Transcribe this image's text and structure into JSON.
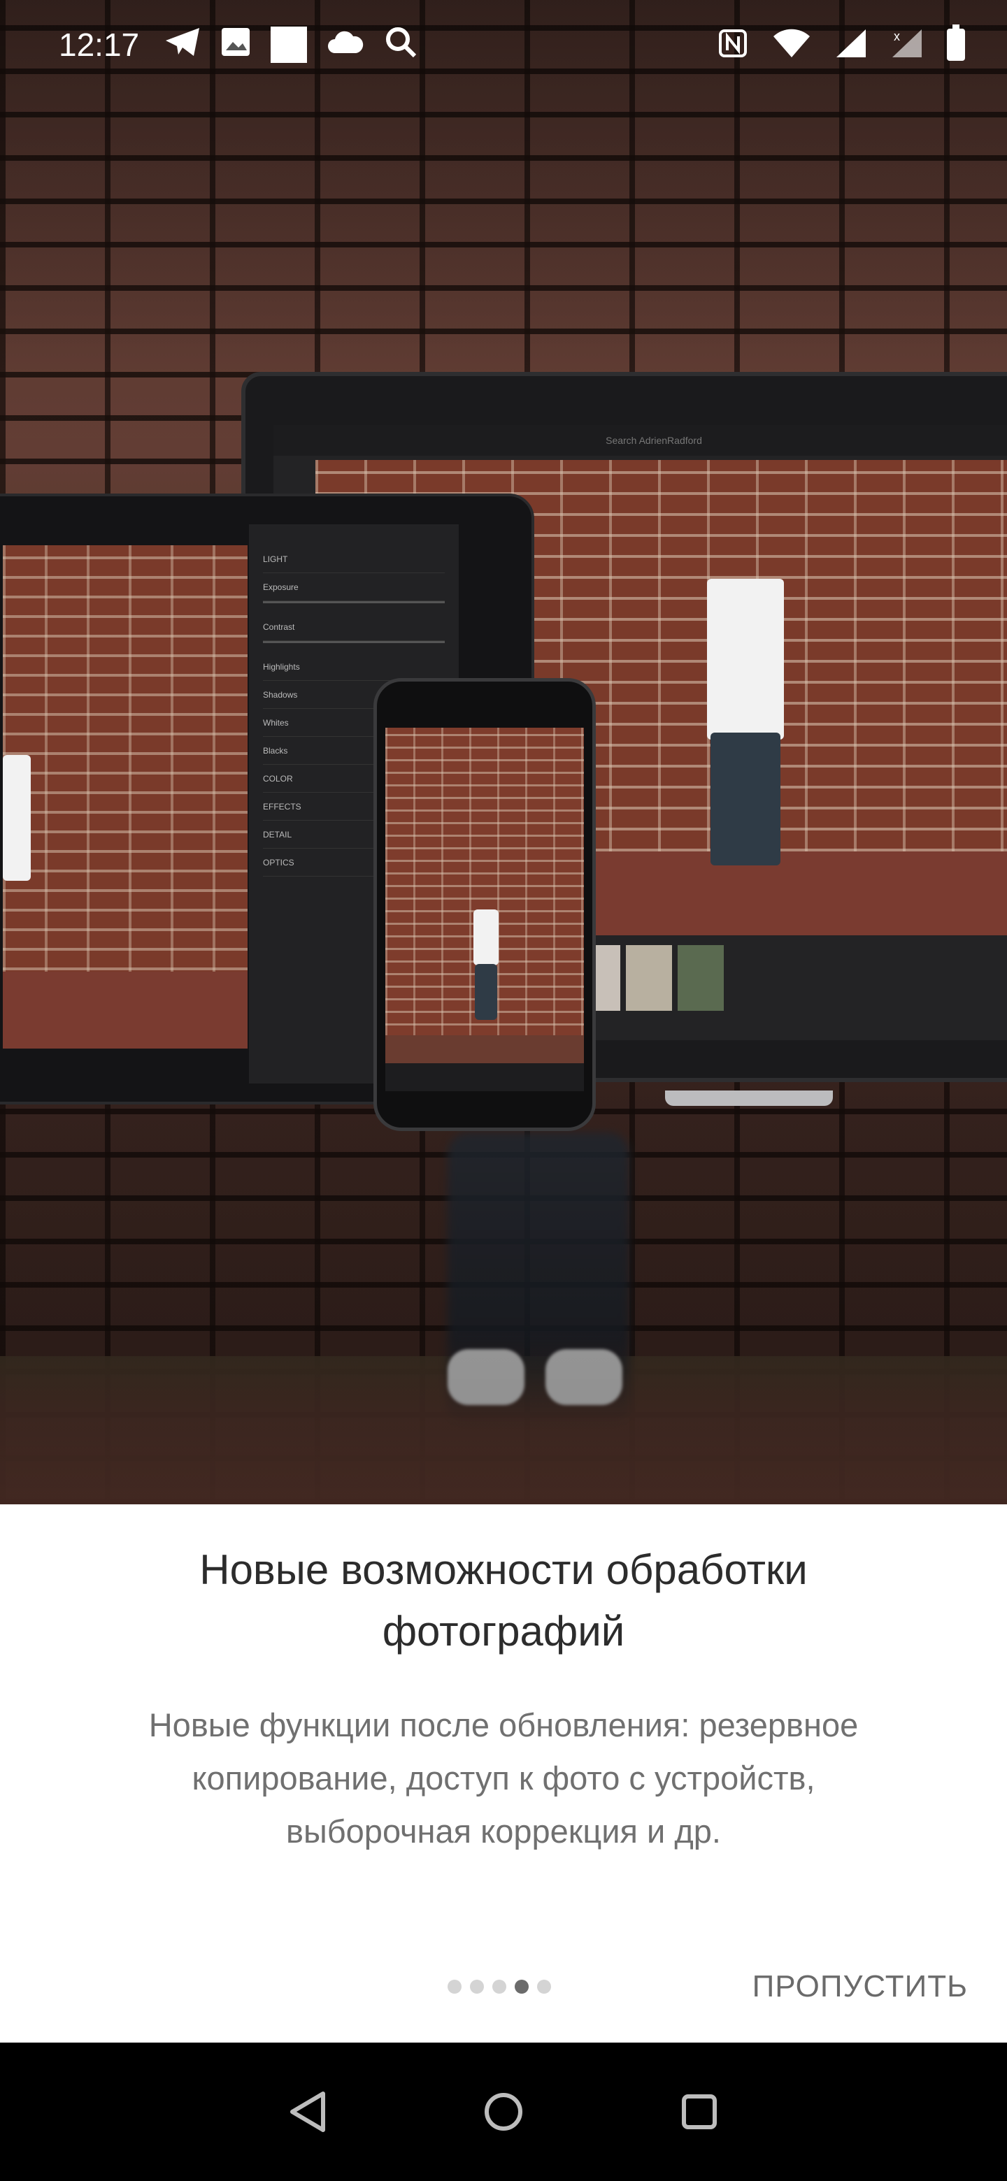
{
  "status_bar": {
    "time": "12:17",
    "left_icons": [
      "telegram-icon",
      "image-icon",
      "square-icon",
      "cloud-icon",
      "search-icon"
    ],
    "right_icons": [
      "nfc-icon",
      "wifi-icon",
      "signal-icon",
      "signal-x-icon",
      "battery-icon"
    ]
  },
  "onboarding": {
    "title": "Новые возможности обработки фотографий",
    "description": "Новые функции после обновления: резервное копирование, доступ к фото с устройств, выборочная коррекция и др.",
    "pagination": {
      "total": 5,
      "active_index": 3
    },
    "skip_label": "ПРОПУСТИТЬ"
  },
  "laptop_ui": {
    "search_placeholder": "Search AdrienRadford"
  },
  "tablet_ui": {
    "panel_items": [
      "LIGHT",
      "Exposure",
      "Contrast",
      "Highlights",
      "Shadows",
      "Whites",
      "Blacks",
      "COLOR",
      "EFFECTS",
      "DETAIL",
      "OPTICS"
    ]
  },
  "nav_bar": {
    "buttons": [
      "back-icon",
      "home-icon",
      "recents-icon"
    ]
  },
  "colors": {
    "skip_text": "#6a6a6a",
    "title_text": "#2c2c2c",
    "body_text": "#707070",
    "dot_active": "#6b6b6b",
    "dot_inactive": "#d4d4d4"
  }
}
